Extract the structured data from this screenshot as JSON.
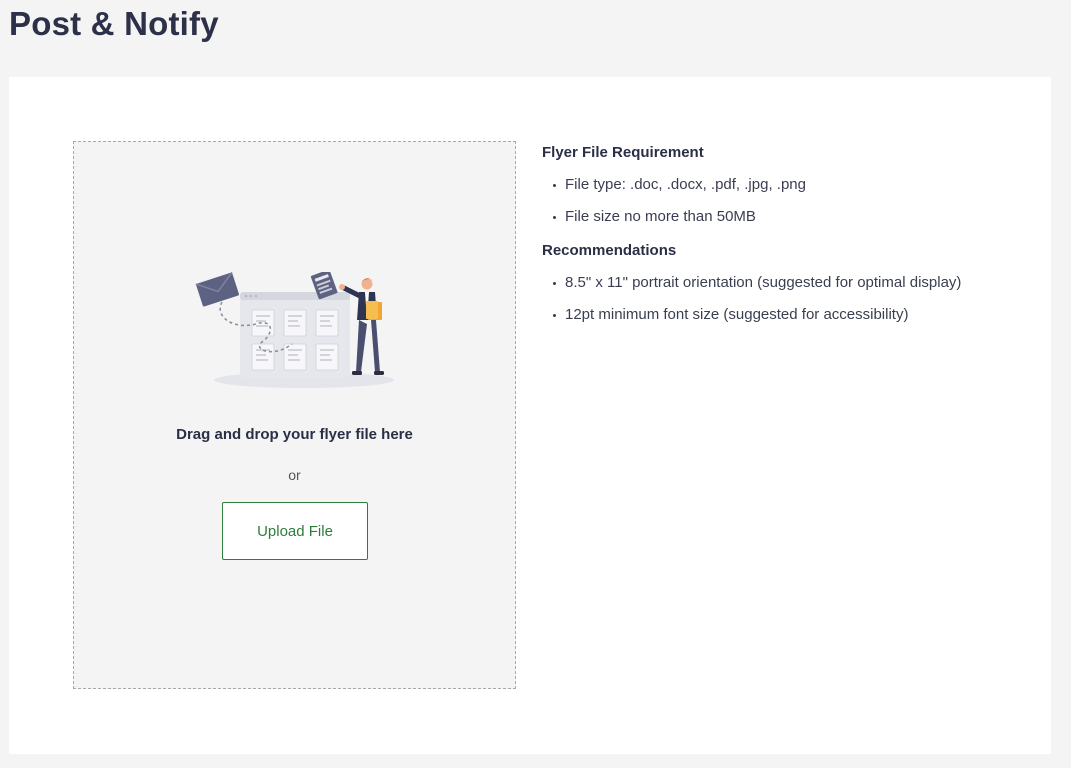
{
  "page": {
    "title": "Post & Notify"
  },
  "dropzone": {
    "illustration_name": "upload-illustration",
    "instruction": "Drag and drop your flyer file here",
    "or_text": "or",
    "upload_button_label": "Upload File"
  },
  "requirements": {
    "heading": "Flyer File Requirement",
    "items": [
      "File type: .doc, .docx, .pdf, .jpg, .png",
      "File size no more than 50MB"
    ]
  },
  "recommendations": {
    "heading": "Recommendations",
    "items": [
      "8.5\" x 11\" portrait orientation (suggested for optimal display)",
      "12pt minimum font size (suggested for accessibility)"
    ]
  },
  "colors": {
    "background": "#f4f4f4",
    "card": "#ffffff",
    "accent_green": "#2e7d3a",
    "title_text": "#2c3048"
  }
}
